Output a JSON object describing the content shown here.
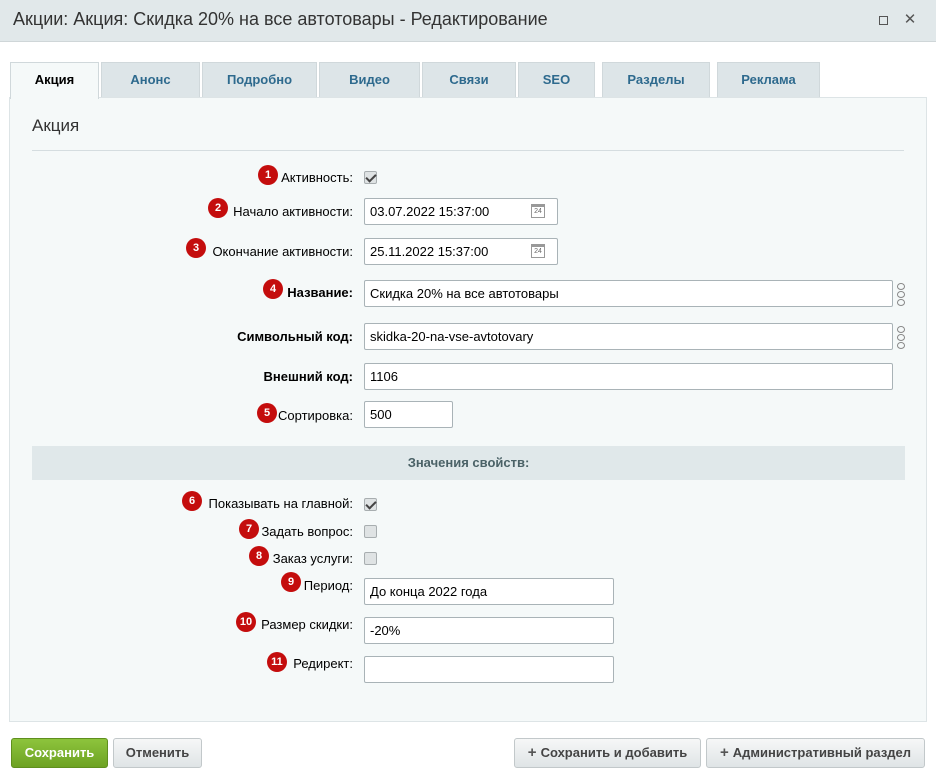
{
  "window": {
    "title": "Акции: Акция: Скидка 20% на все автотовары - Редактирование",
    "maximize_icon": "maximize-icon",
    "close_icon": "close-icon",
    "close_glyph": "✕"
  },
  "tabs": [
    "Акция",
    "Анонс",
    "Подробно",
    "Видео",
    "Связи",
    "SEO",
    "Разделы",
    "Реклама"
  ],
  "panel": {
    "title": "Акция",
    "fields": {
      "active_label": "Активность:",
      "active_checked": true,
      "start_label": "Начало активности:",
      "start_value": "03.07.2022 15:37:00",
      "end_label": "Окончание активности:",
      "end_value": "25.11.2022 15:37:00",
      "name_label": "Название:",
      "name_value": "Скидка 20% на все автотовары",
      "code_label": "Символьный код:",
      "code_value": "skidka-20-na-vse-avtotovary",
      "ext_label": "Внешний код:",
      "ext_value": "1106",
      "sort_label": "Сортировка:",
      "sort_value": "500"
    },
    "section_title": "Значения свойств:",
    "props": {
      "show_main_label": "Показывать на главной:",
      "show_main_checked": true,
      "ask_label": "Задать вопрос:",
      "ask_checked": false,
      "order_label": "Заказ услуги:",
      "order_checked": false,
      "period_label": "Период:",
      "period_value": "До конца 2022 года",
      "discount_label": "Размер скидки:",
      "discount_value": "-20%",
      "redirect_label": "Редирект:",
      "redirect_value": ""
    },
    "calendar_icon_text": "24",
    "markers": [
      "1",
      "2",
      "3",
      "4",
      "5",
      "6",
      "7",
      "8",
      "9",
      "10",
      "11"
    ],
    "marker_color": "#c40d0d"
  },
  "footer": {
    "save": "Сохранить",
    "cancel": "Отменить",
    "save_add": "Сохранить и добавить",
    "admin": "Административный раздел"
  }
}
